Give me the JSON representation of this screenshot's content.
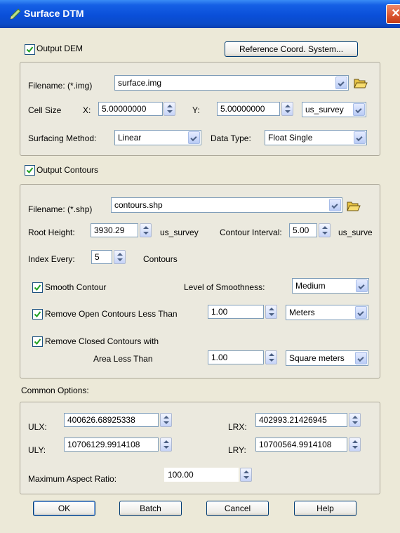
{
  "window": {
    "title": "Surface DTM",
    "close_glyph": "✕"
  },
  "output_dem": {
    "checkbox_label": "Output DEM",
    "checked": true,
    "ref_coord_button": "Reference Coord. System...",
    "filename_label": "Filename: (*.img)",
    "filename_value": "surface.img",
    "cell_size_label": "Cell Size",
    "x_label": "X:",
    "x_value": "5.00000000",
    "y_label": "Y:",
    "y_value": "5.00000000",
    "unit_value": "us_survey",
    "surfacing_method_label": "Surfacing Method:",
    "surfacing_method_value": "Linear",
    "data_type_label": "Data Type:",
    "data_type_value": "Float Single"
  },
  "output_contours": {
    "checkbox_label": "Output Contours",
    "checked": true,
    "filename_label": "Filename: (*.shp)",
    "filename_value": "contours.shp",
    "root_height_label": "Root Height:",
    "root_height_value": "3930.29",
    "root_height_unit": "us_survey",
    "contour_interval_label": "Contour Interval:",
    "contour_interval_value": "5.00",
    "contour_interval_unit": "us_surve",
    "index_every_label": "Index Every:",
    "index_every_value": "5",
    "contours_label": "Contours",
    "smooth_contour_label": "Smooth Contour",
    "smooth_checked": true,
    "level_smoothness_label": "Level of Smoothness:",
    "level_smoothness_value": "Medium",
    "remove_open_label": "Remove Open Contours Less Than",
    "remove_open_checked": true,
    "remove_open_value": "1.00",
    "remove_open_unit": "Meters",
    "remove_closed_label": "Remove Closed Contours with",
    "remove_closed_checked": true,
    "area_less_than_label": "Area Less Than",
    "remove_closed_value": "1.00",
    "remove_closed_unit": "Square meters"
  },
  "common_options": {
    "heading": "Common Options:",
    "ulx_label": "ULX:",
    "ulx_value": "400626.68925338",
    "lrx_label": "LRX:",
    "lrx_value": "402993.21426945",
    "uly_label": "ULY:",
    "uly_value": "10706129.9914108",
    "lry_label": "LRY:",
    "lry_value": "10700564.9914108",
    "max_aspect_label": "Maximum Aspect Ratio:",
    "max_aspect_value": "100.00"
  },
  "buttons": {
    "ok": "OK",
    "batch": "Batch",
    "cancel": "Cancel",
    "help": "Help"
  },
  "colors": {
    "title_bar": "#0a4fd9",
    "dialog_bg": "#ece9d8",
    "checkmark": "#21a121"
  },
  "icons": [
    "pencil-icon",
    "open-folder-icon",
    "checkmark-icon",
    "spin-up-icon",
    "spin-down-icon",
    "dropdown-arrow-icon",
    "close-icon"
  ]
}
